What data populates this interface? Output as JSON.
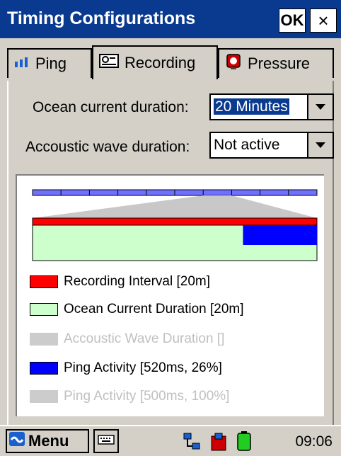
{
  "window": {
    "title": "Timing Configurations",
    "ok_label": "OK",
    "close_label": "×"
  },
  "tabs": [
    {
      "label": "Ping",
      "icon": "bars-icon",
      "active": false
    },
    {
      "label": "Recording",
      "icon": "recorder-icon",
      "active": true
    },
    {
      "label": "Pressure",
      "icon": "gauge-icon",
      "active": false
    }
  ],
  "fields": {
    "ocean_current": {
      "label": "Ocean current duration:",
      "value": "20 Minutes"
    },
    "acoustic_wave": {
      "label": "Accoustic wave duration:",
      "value": "Not active"
    }
  },
  "legend": [
    {
      "label": "Recording Interval [20m]",
      "color": "#ff0000",
      "active": true
    },
    {
      "label": "Ocean Current Duration [20m]",
      "color": "#ccffcc",
      "active": true
    },
    {
      "label": "Accoustic Wave Duration []",
      "color": "#cccccc",
      "active": false
    },
    {
      "label": "Ping Activity [520ms, 26%]",
      "color": "#0000ff",
      "active": true
    },
    {
      "label": "Ping Activity [500ms, 100%]",
      "color": "#cccccc",
      "active": false
    }
  ],
  "chart_data": {
    "type": "timeline",
    "overview_segments": 10,
    "highlighted_segment": 6,
    "recording_interval_minutes": 20,
    "ocean_current_minutes": 20,
    "ping_activity_percent": 26
  },
  "taskbar": {
    "menu_label": "Menu",
    "time": "09:06"
  },
  "colors": {
    "titlebar": "#0a3a8f",
    "panel": "#d4d0c8",
    "disabled_text": "#c0c0c0"
  }
}
